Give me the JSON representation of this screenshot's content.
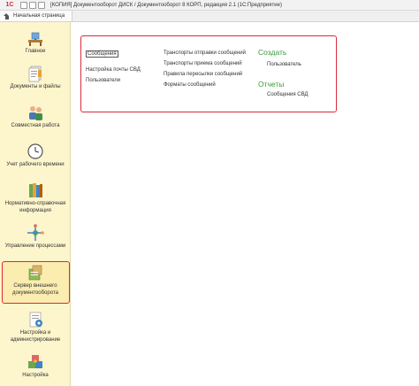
{
  "window": {
    "logo": "1С",
    "title": "[КОПИЯ] Документооборот ДИСК / Документооборот 8 КОРП, редакция 2.1  (1С:Предприятие)"
  },
  "tabs": {
    "home_label": "Начальная страница"
  },
  "sidebar": {
    "items": [
      {
        "label": "Главное",
        "icon": "desk-icon"
      },
      {
        "label": "Документы и файлы",
        "icon": "documents-icon"
      },
      {
        "label": "Совместная работа",
        "icon": "people-icon"
      },
      {
        "label": "Учет рабочего времени",
        "icon": "clock-icon"
      },
      {
        "label": "Нормативно-справочная информация",
        "icon": "books-icon"
      },
      {
        "label": "Управление процессами",
        "icon": "process-icon"
      },
      {
        "label": "Сервер внешнего документооборота",
        "icon": "server-icon"
      },
      {
        "label": "Настройка и администрирование",
        "icon": "settings-doc-icon"
      },
      {
        "label": "Настройка",
        "icon": "puzzle-icon"
      }
    ],
    "selected_index": 6
  },
  "main": {
    "col1": [
      "Сообщения",
      "Настройка почты СВД",
      "Пользователи"
    ],
    "col2": [
      "Транспорты отправки сообщений",
      "Транспорты приема сообщений",
      "Правила пересылки сообщений",
      "Форматы сообщений"
    ],
    "create_heading": "Создать",
    "create_items": [
      "Пользователь"
    ],
    "reports_heading": "Отчеты",
    "reports_items": [
      "Сообщения СВД"
    ]
  },
  "colors": {
    "accent_red": "#d92b3a",
    "sidebar_bg": "#fdf5cc",
    "heading_green": "#3c9a3c"
  }
}
